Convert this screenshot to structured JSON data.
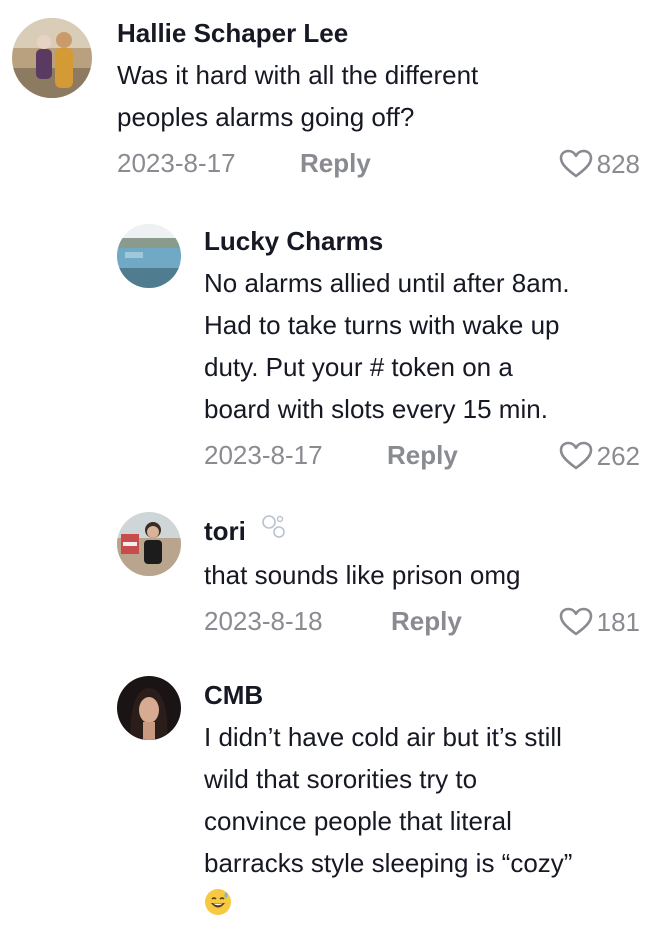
{
  "comments": [
    {
      "username": "Hallie Schaper Lee",
      "text": "Was it hard with all the different\npeoples alarms going off?",
      "date": "2023-8-17",
      "reply_label": "Reply",
      "likes": "828",
      "avatar_icon": "photo-two-women"
    },
    {
      "username": "Lucky Charms",
      "text": "No alarms allied until after 8am.\nHad to take turns with wake up\nduty. Put your # token on a\nboard with slots every 15 min.",
      "date": "2023-8-17",
      "reply_label": "Reply",
      "likes": "262",
      "avatar_icon": "photo-pool-landscape"
    },
    {
      "username": "tori",
      "username_badge_icon": "bubbles-icon",
      "text": "that sounds like prison omg",
      "date": "2023-8-18",
      "reply_label": "Reply",
      "likes": "181",
      "avatar_icon": "photo-woman-outdoors"
    },
    {
      "username": "CMB",
      "text": "I didn’t have cold air but it’s still\nwild that sororities try to\nconvince people that literal\nbarracks style sleeping is “cozy”",
      "emoji_icon": "grinning-sweat-emoji",
      "avatar_icon": "photo-woman-dark-hair"
    }
  ],
  "colors": {
    "text": "#161823",
    "secondary": "#8a8b91"
  }
}
